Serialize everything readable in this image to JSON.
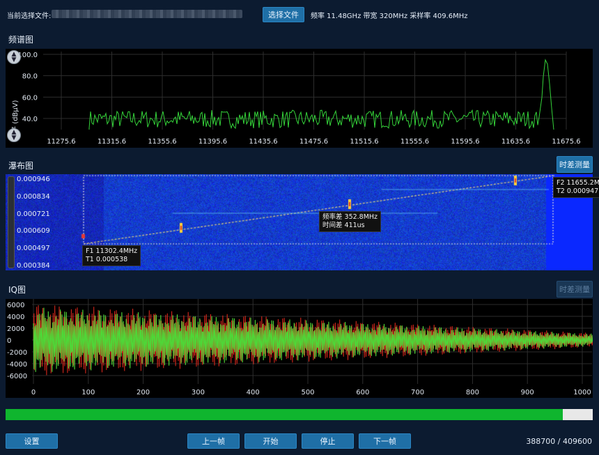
{
  "header": {
    "file_label": "当前选择文件:",
    "select_file_button": "选择文件",
    "signal_info": "频率 11.48GHz 带宽 320MHz 采样率 409.6MHz"
  },
  "spectrum": {
    "title": "频谱图",
    "ylabel": "电平 (dBμV)",
    "y_ticks": [
      "100.0",
      "80.0",
      "60.0",
      "40.0"
    ],
    "x_ticks": [
      "11275.6",
      "11315.6",
      "11355.6",
      "11395.6",
      "11435.6",
      "11475.6",
      "11515.6",
      "11555.6",
      "11595.6",
      "11635.6",
      "11675.6"
    ]
  },
  "waterfall": {
    "title": "瀑布图",
    "measure_button": "时差测量",
    "y_ticks": [
      "0.000946",
      "0.000834",
      "0.000721",
      "0.000609",
      "0.000497",
      "0.000384"
    ],
    "marker1": {
      "freq": "F1 11302.4MHz",
      "time": "T1 0.000538"
    },
    "marker2": {
      "freq": "F2 11655.2M",
      "time": "T2 0.000947"
    },
    "delta": {
      "freq": "频率差 352.8MHz",
      "time": "时间差 411us"
    }
  },
  "iq": {
    "title": "IQ图",
    "measure_button": "时差测量",
    "y_ticks": [
      "6000",
      "4000",
      "2000",
      "0",
      "-2000",
      "-4000",
      "-6000"
    ],
    "x_ticks": [
      "0",
      "100",
      "200",
      "300",
      "400",
      "500",
      "600",
      "700",
      "800",
      "900",
      "1000"
    ]
  },
  "controls": {
    "settings": "设置",
    "prev": "上一帧",
    "start": "开始",
    "stop": "停止",
    "next": "下一帧",
    "counter": "388700  /  409600",
    "progress_fraction": 0.949
  },
  "colors": {
    "background": "#0c1b30",
    "button": "#1f6fa6",
    "spectrum_trace": "#35d43a",
    "iq_i": "#e0291d",
    "iq_q": "#4fd637",
    "progress": "#0fb52e"
  }
}
